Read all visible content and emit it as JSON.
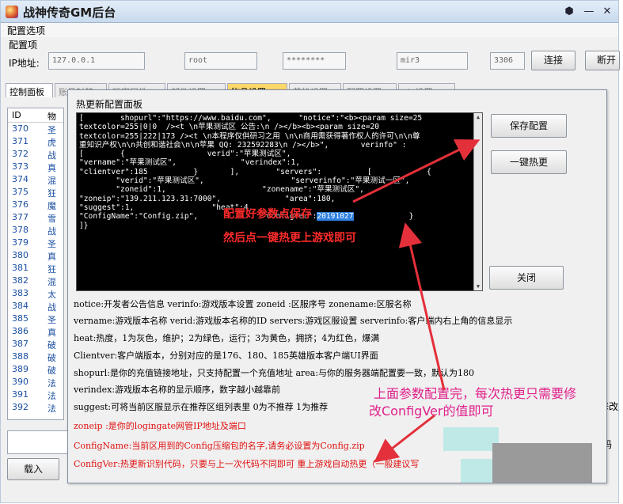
{
  "window": {
    "title": "战神传奇GM后台",
    "menu_item": "配置选项",
    "group_label": "配置项"
  },
  "connection": {
    "ip_label": "IP地址:",
    "ip_value": "127.0.0.1",
    "user_value": "root",
    "password_value": "********",
    "db_value": "mir3",
    "port_value": "3306",
    "connect_label": "连接",
    "disconnect_label": "断开"
  },
  "tabs": [
    {
      "label": "控制面板"
    },
    {
      "label": "账号封禁"
    },
    {
      "label": "玩家属性"
    },
    {
      "label": "邮件设置"
    },
    {
      "label": "物品设置"
    },
    {
      "label": "英雄设置"
    },
    {
      "label": "配置设置"
    },
    {
      "label": "vip设置"
    }
  ],
  "list": {
    "col_id": "ID",
    "col_name": "物",
    "rows": [
      {
        "id": "370",
        "name": "圣"
      },
      {
        "id": "371",
        "name": "虎"
      },
      {
        "id": "372",
        "name": "战"
      },
      {
        "id": "373",
        "name": "真"
      },
      {
        "id": "374",
        "name": "混"
      },
      {
        "id": "375",
        "name": "狂"
      },
      {
        "id": "376",
        "name": "魔"
      },
      {
        "id": "377",
        "name": "雪"
      },
      {
        "id": "378",
        "name": "战"
      },
      {
        "id": "379",
        "name": "圣"
      },
      {
        "id": "380",
        "name": "真"
      },
      {
        "id": "381",
        "name": "狂"
      },
      {
        "id": "382",
        "name": "混"
      },
      {
        "id": "383",
        "name": "太"
      },
      {
        "id": "384",
        "name": "战"
      },
      {
        "id": "385",
        "name": "圣"
      },
      {
        "id": "386",
        "name": "真"
      },
      {
        "id": "387",
        "name": "破"
      },
      {
        "id": "388",
        "name": "破"
      },
      {
        "id": "389",
        "name": "破"
      },
      {
        "id": "390",
        "name": "法"
      },
      {
        "id": "391",
        "name": "法"
      },
      {
        "id": "392",
        "name": "法"
      }
    ]
  },
  "bottom": {
    "load_label": "载入",
    "right_fragment_1": "修改",
    "right_fragment_2": "式代码"
  },
  "dialog": {
    "title": "热更新配置面板",
    "save_label": "保存配置",
    "hotupdate_label": "一键热更",
    "close_label": "关闭",
    "console_lines": [
      "[        shopurl\":\"https://www.baidu.com\",      \"notice\":\"<b><param size=25",
      "textcolor=255|0|0  /><t \\n苹果测试区 公告:\\n /></b><b><param size=20",
      "textcolor=255|222|173 /><t \\n本程序仅供研习之用 \\n\\n商用需获得著作权人的许可\\n\\n尊",
      "重知识产权\\n\\n共创和谐社会\\n\\n苹果 QQ: 232592283\\n /></b>\",       verinfo\" :",
      "[        {                  verid\":\"苹果测试区\",",
      "\"vername\":\"苹果测试区\",              \"verindex\":1,",
      "\"clientver\":185          }       ],        \"servers\":          [            {",
      "        \"verid\":\"苹果测试区\",                   \"serverinfo\":\"苹果测试一区\",",
      "        \"zoneid\":1,                     \"zonename\":\"苹果测试区\",",
      "\"zoneip\":\"139.211.123.31:7000\",              \"area\":180,",
      "\"suggest\":1,                 \"heat\":4,",
      "\"ConfigName\":\"Config.zip\",              \"ConfigVer\":"
    ],
    "config_ver": "20191027",
    "console_tail": "}",
    "console_last_line": "]}",
    "overlay_line1": "配置好参数点保存",
    "overlay_line2": "然后点一键热更上游戏即可",
    "descriptions": [
      "notice:开发者公告信息   verinfo:游戏版本设置   zoneid :区服序号   zonename:区服名称",
      "vername:游戏版本名称   verid:游戏版本名称的ID   servers:游戏区服设置   serverinfo:客户端内右上角的信息显示",
      "heat:热度，1为灰色，维护；2为绿色，运行；3为黄色，拥挤；4为红色，爆满",
      "Clientver:客户端版本，分别对应的是176、180、185英雄版本客户端UI界面",
      "shopurl:是你的充值链接地址，只支持配置一个充值地址        area:与你的服务器端配置要一致，默认为180",
      "verindex:游戏版本名称的显示顺序，数字越小越靠前",
      "suggest:可将当前区服显示在推荐区组列表里 0为不推荐 1为推荐"
    ],
    "red_descriptions": [
      "zoneip :是你的logingate网管IP地址及端口",
      "ConfigName:当前区用到的Config压缩包的名字,请务必设置为Config.zip",
      "ConfigVer:热更新识别代码，只要与上一次代码不同即可 重上游戏自动热更（一般建议写"
    ],
    "annotation_line1": "上面参数配置完，每次热更只需要修",
    "annotation_line2": "改ConfigVer的值即可"
  },
  "colors": {
    "annotation_red": "#ff2b2b",
    "annotation_pink": "#e0208a",
    "desc_red": "#e01010",
    "highlight": "#2c7fe0",
    "console_bg": "#000000"
  }
}
